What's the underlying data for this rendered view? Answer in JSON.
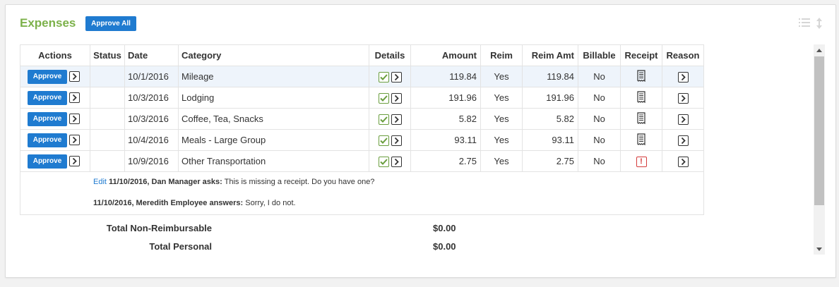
{
  "panel": {
    "title": "Expenses",
    "approve_all_label": "Approve All",
    "icons": [
      "list-icon",
      "sort-icon"
    ]
  },
  "table": {
    "headers": {
      "actions": "Actions",
      "status": "Status",
      "date": "Date",
      "category": "Category",
      "details": "Details",
      "amount": "Amount",
      "reim": "Reim",
      "reim_amt": "Reim Amt",
      "billable": "Billable",
      "receipt": "Receipt",
      "reason": "Reason"
    },
    "approve_label": "Approve",
    "rows": [
      {
        "date": "10/1/2016",
        "category": "Mileage",
        "amount": "119.84",
        "reim": "Yes",
        "reim_amt": "119.84",
        "billable": "No",
        "receipt": "receipt-icon"
      },
      {
        "date": "10/3/2016",
        "category": "Lodging",
        "amount": "191.96",
        "reim": "Yes",
        "reim_amt": "191.96",
        "billable": "No",
        "receipt": "receipt-icon"
      },
      {
        "date": "10/3/2016",
        "category": "Coffee, Tea, Snacks",
        "amount": "5.82",
        "reim": "Yes",
        "reim_amt": "5.82",
        "billable": "No",
        "receipt": "receipt-icon"
      },
      {
        "date": "10/4/2016",
        "category": "Meals - Large Group",
        "amount": "93.11",
        "reim": "Yes",
        "reim_amt": "93.11",
        "billable": "No",
        "receipt": "receipt-icon"
      },
      {
        "date": "10/9/2016",
        "category": "Other Transportation",
        "amount": "2.75",
        "reim": "Yes",
        "reim_amt": "2.75",
        "billable": "No",
        "receipt": "missing-receipt-icon"
      }
    ],
    "notes": {
      "edit_label": "Edit",
      "question_head": "11/10/2016, Dan Manager asks:",
      "question_text": "This is missing a receipt. Do you have one?",
      "answer_head": "11/10/2016, Meredith Employee answers:",
      "answer_text": "Sorry, I do not."
    }
  },
  "totals": [
    {
      "label": "Total Non-Reimbursable",
      "value": "$0.00"
    },
    {
      "label": "Total Personal",
      "value": "$0.00"
    }
  ],
  "colors": {
    "title": "#7cb14a",
    "primary_button": "#1f7bd0",
    "row_highlight": "#eef4fb",
    "warning": "#d43b3b",
    "check": "#6a9e3e"
  }
}
